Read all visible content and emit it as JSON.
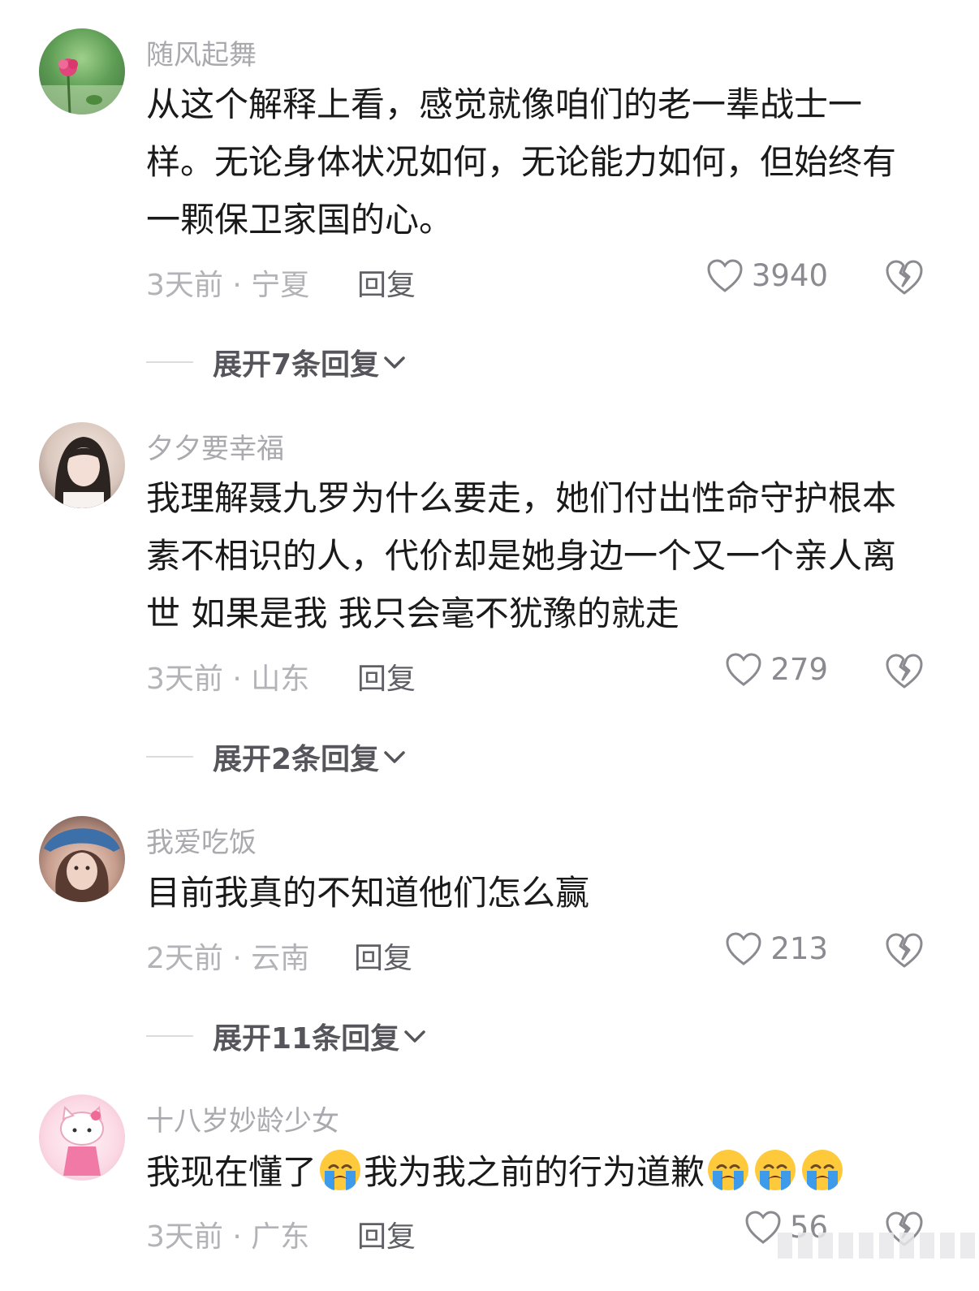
{
  "comments": [
    {
      "username": "随风起舞",
      "lines": [
        "从这个解释上看，感觉就像咱们的老一辈战士一",
        "样。无论身体状况如何，无论能力如何，但始终有",
        "一颗保卫家国的心。"
      ],
      "meta": "3天前 · 宁夏",
      "reply": "回复",
      "likes": "3940",
      "expand": "展开7条回复",
      "avatar_icon": "flower-avatar"
    },
    {
      "username": "夕夕要幸福",
      "lines": [
        "我理解聂九罗为什么要走，她们付出性命守护根本",
        "素不相识的人，代价却是她身边一个又一个亲人离",
        "世 如果是我 我只会毫不犹豫的就走"
      ],
      "meta": "3天前 · 山东",
      "reply": "回复",
      "likes": "279",
      "expand": "展开2条回复",
      "avatar_icon": "girl-avatar"
    },
    {
      "username": "我爱吃饭",
      "lines": [
        "目前我真的不知道他们怎么赢"
      ],
      "meta": "2天前 · 云南",
      "reply": "回复",
      "likes": "213",
      "expand": "展开11条回复",
      "avatar_icon": "cap-girl-avatar"
    },
    {
      "username": "十八岁妙龄少女",
      "text_a": "我现在懂了",
      "text_b": "我为我之前的行为道歉",
      "emoji_name": "loudly-crying-face-emoji",
      "meta": "3天前 · 广东",
      "reply": "回复",
      "likes": "56",
      "avatar_icon": "hello-kitty-avatar"
    }
  ],
  "colors": {
    "username": "#a9a9ae",
    "content": "#1a1a1a",
    "meta": "#b2b2b7",
    "reply": "#5f5f66",
    "expand": "#55555b"
  }
}
